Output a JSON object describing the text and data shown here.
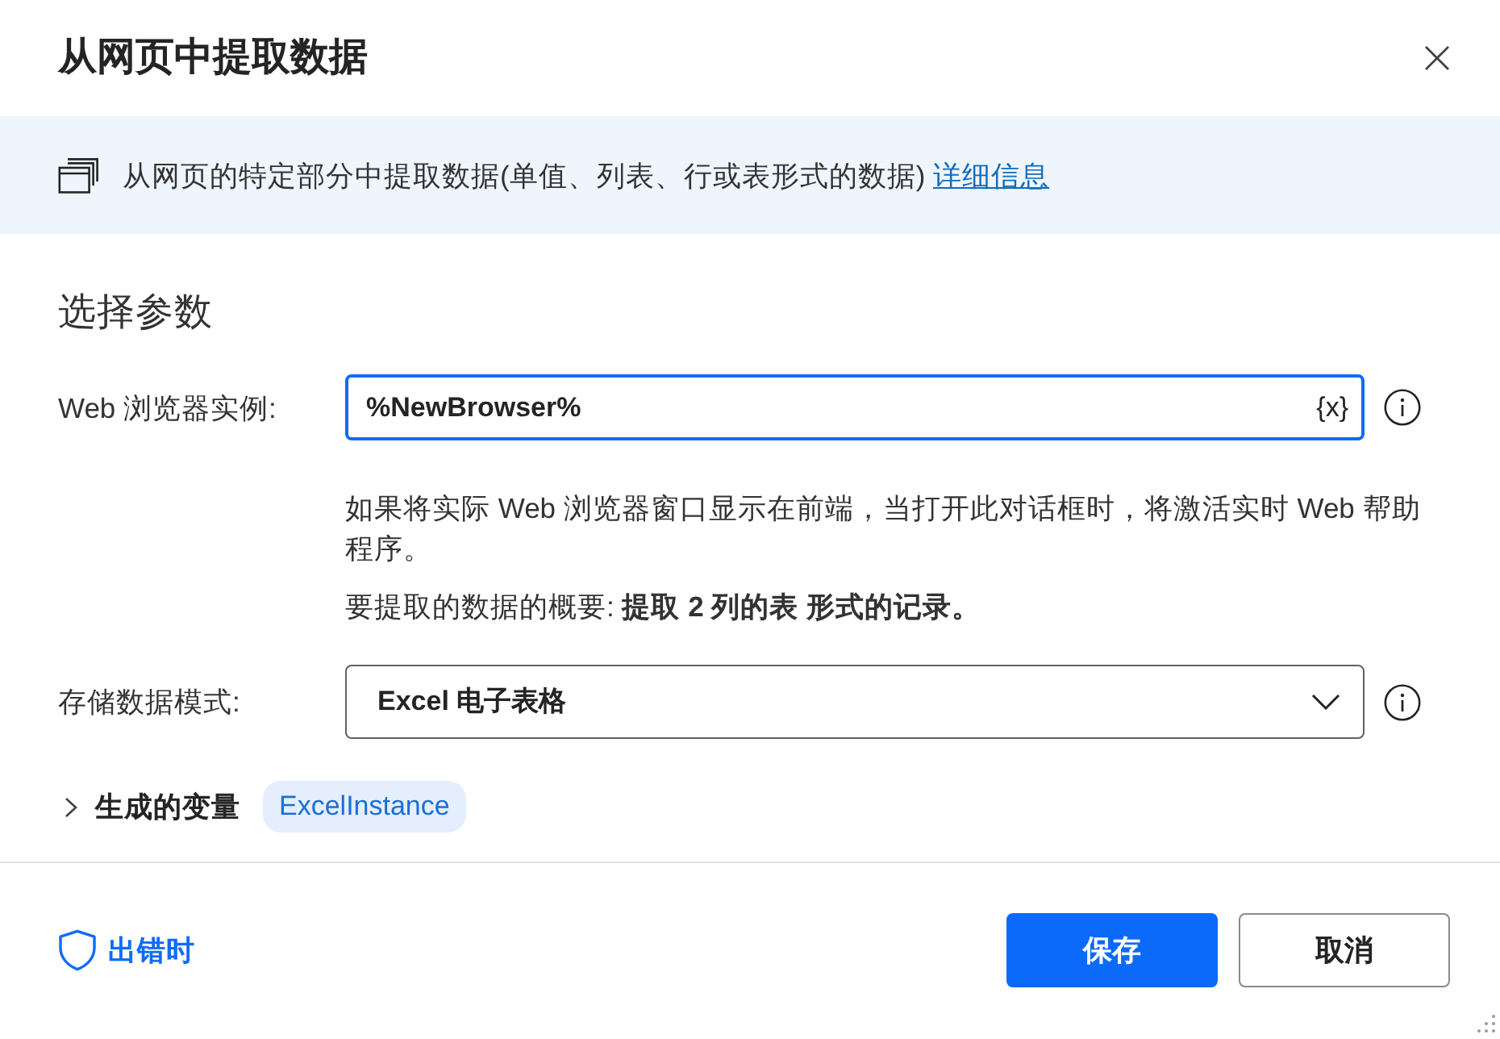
{
  "dialog": {
    "title": "从网页中提取数据"
  },
  "info_banner": {
    "text": "从网页的特定部分中提取数据(单值、列表、行或表形式的数据)",
    "link": "详细信息"
  },
  "section_title": "选择参数",
  "fields": [
    {
      "kind": "text",
      "label": "Web 浏览器实例:",
      "value": "%NewBrowser%",
      "variable_button": "{x}",
      "focused": true,
      "notes": [
        "如果将实际 Web 浏览器窗口显示在前端，当打开此对话框时，将激活实时 Web 帮助程序。",
        "要提取的数据的概要: **提取 2 列的表 形式的记录。**"
      ]
    },
    {
      "kind": "dropdown",
      "label": "存储数据模式:",
      "value": "Excel 电子表格",
      "focused": false
    }
  ],
  "generated_variables": {
    "label": "生成的变量",
    "expanded": false,
    "variables": [
      "ExcelInstance"
    ]
  },
  "footer": {
    "on_error": "出错时",
    "buttons": [
      {
        "label": "保存",
        "kind": "primary"
      },
      {
        "label": "取消",
        "kind": "secondary"
      }
    ]
  }
}
